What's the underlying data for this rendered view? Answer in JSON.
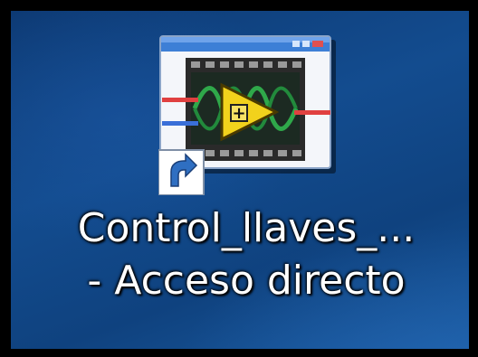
{
  "desktop": {
    "shortcut": {
      "label_line1": "Control_llaves_...",
      "label_line2": "- Acceso directo",
      "icon": "labview-vi-icon",
      "overlay_icon": "shortcut-arrow-icon"
    }
  },
  "colors": {
    "desktop_blue": "#134c8f",
    "vi_yellow": "#f2d21c",
    "wire_green": "#2fa84a",
    "titlebar_blue": "#3d7fd6"
  }
}
